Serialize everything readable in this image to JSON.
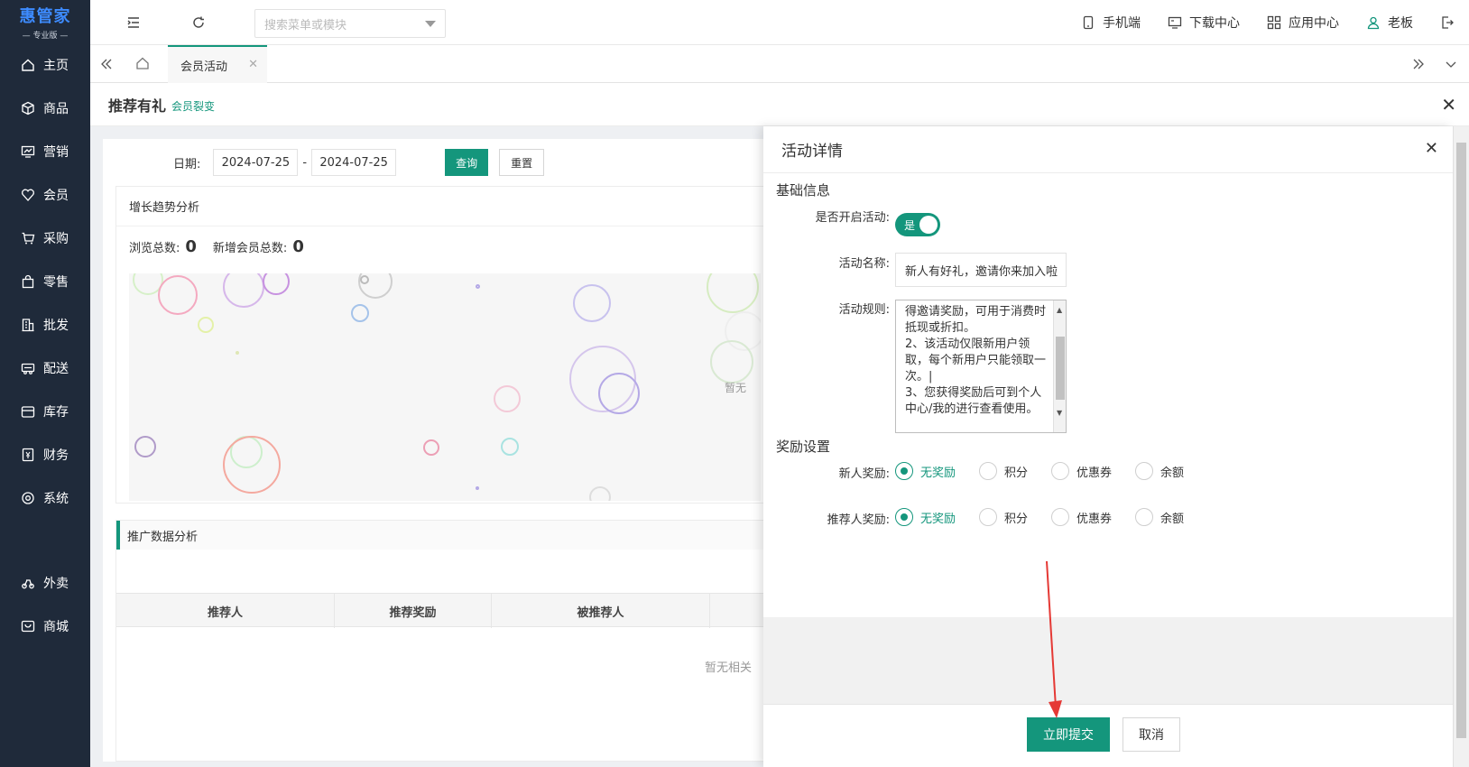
{
  "brand": {
    "name": "惠管家",
    "edition": "— 专业版 —"
  },
  "sidebar": {
    "items": [
      {
        "label": "主页",
        "icon": "home-icon"
      },
      {
        "label": "商品",
        "icon": "box-icon"
      },
      {
        "label": "营销",
        "icon": "chart-icon"
      },
      {
        "label": "会员",
        "icon": "heart-icon"
      },
      {
        "label": "采购",
        "icon": "cart-icon"
      },
      {
        "label": "零售",
        "icon": "bag-icon"
      },
      {
        "label": "批发",
        "icon": "building-icon"
      },
      {
        "label": "配送",
        "icon": "truck-icon"
      },
      {
        "label": "库存",
        "icon": "warehouse-icon"
      },
      {
        "label": "财务",
        "icon": "finance-icon"
      },
      {
        "label": "系统",
        "icon": "settings-icon"
      }
    ],
    "extra": [
      {
        "label": "外卖",
        "icon": "delivery-icon"
      },
      {
        "label": "商城",
        "icon": "store-icon"
      }
    ]
  },
  "topbar": {
    "search_placeholder": "搜索菜单或模块",
    "links": [
      {
        "label": "手机端",
        "icon": "mobile-icon"
      },
      {
        "label": "下载中心",
        "icon": "monitor-icon"
      },
      {
        "label": "应用中心",
        "icon": "apps-icon"
      },
      {
        "label": "老板",
        "icon": "user-icon"
      }
    ]
  },
  "tabs": {
    "active": "会员活动"
  },
  "page": {
    "title": "推荐有礼",
    "subtitle": "会员裂变"
  },
  "filter": {
    "date_label": "日期:",
    "start": "2024-07-25",
    "sep": "-",
    "end": "2024-07-25",
    "query": "查询",
    "reset": "重置"
  },
  "growth": {
    "title": "增长趋势分析",
    "views_label": "浏览总数:",
    "views": "0",
    "members_label": "新增会员总数:",
    "members": "0",
    "empty": "暂无"
  },
  "promo": {
    "title": "推广数据分析",
    "columns": [
      "推荐人",
      "推荐奖励",
      "被推荐人"
    ],
    "empty": "暂无相关"
  },
  "drawer": {
    "title": "活动详情",
    "basic_title": "基础信息",
    "enable_label": "是否开启活动:",
    "enable_value": "是",
    "name_label": "活动名称:",
    "name_value": "新人有好礼，邀请你来加入啦",
    "rules_label": "活动规则:",
    "rules_value": "得邀请奖励，可用于消费时抵现或折扣。\n2、该活动仅限新用户领取，每个新用户只能领取一次。|\n3、您获得奖励后可到个人中心/我的进行查看使用。",
    "reward_title": "奖励设置",
    "new_reward_label": "新人奖励:",
    "ref_reward_label": "推荐人奖励:",
    "reward_options": [
      "无奖励",
      "积分",
      "优惠券",
      "余额"
    ],
    "selected": "无奖励",
    "submit": "立即提交",
    "cancel": "取消"
  },
  "colors": {
    "sidebar": "#1f2a3a",
    "accent": "#14967c",
    "annotation": "#e53935"
  }
}
